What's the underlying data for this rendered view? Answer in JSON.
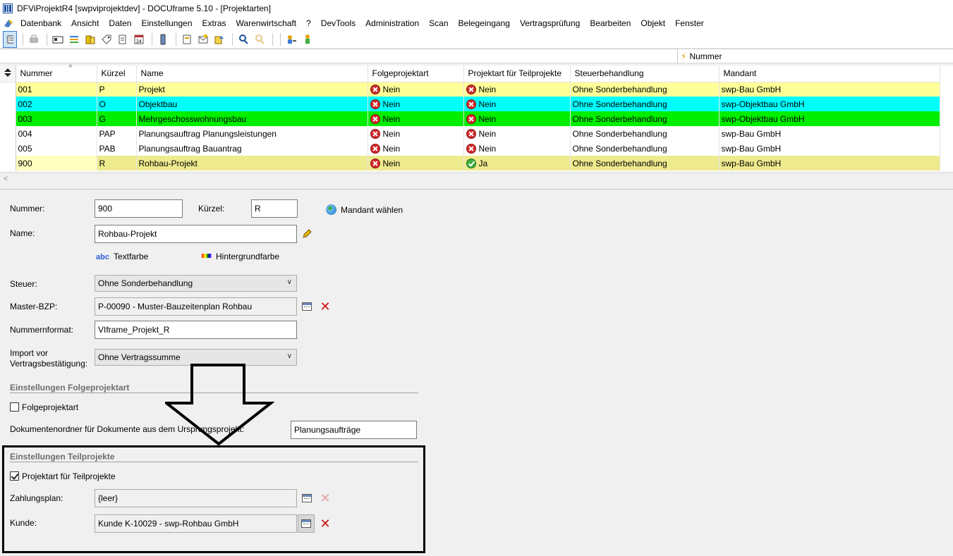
{
  "window": {
    "title": "DFViProjektR4 [swpviprojektdev] - DOCUframe 5.10 - [Projektarten]"
  },
  "menu": [
    "Datenbank",
    "Ansicht",
    "Daten",
    "Einstellungen",
    "Extras",
    "Warenwirtschaft",
    "?",
    "DevTools",
    "Administration",
    "Scan",
    "Belegeingang",
    "Vertragsprüfung",
    "Bearbeiten",
    "Objekt",
    "Fenster"
  ],
  "groupby": {
    "label": "Nummer"
  },
  "grid": {
    "columns": [
      "Nummer",
      "Kürzel",
      "Name",
      "Folgeprojektart",
      "Projektart für Teilprojekte",
      "Steuerbehandlung",
      "Mandant"
    ],
    "rows": [
      {
        "nummer": "001",
        "kuerzel": "P",
        "name": "Projekt",
        "folge": "Nein",
        "teil": "Nein",
        "teil_ok": false,
        "steuer": "Ohne Sonderbehandlung",
        "mandant": "swp-Bau GmbH",
        "color": "#ffff99"
      },
      {
        "nummer": "002",
        "kuerzel": "O",
        "name": "Objektbau",
        "folge": "Nein",
        "teil": "Nein",
        "teil_ok": false,
        "steuer": "Ohne Sonderbehandlung",
        "mandant": "swp-Objektbau GmbH",
        "color": "#00ffff"
      },
      {
        "nummer": "003",
        "kuerzel": "G",
        "name": "Mehrgeschosswohnungsbau",
        "folge": "Nein",
        "teil": "Nein",
        "teil_ok": false,
        "steuer": "Ohne Sonderbehandlung",
        "mandant": "swp-Objektbau GmbH",
        "color": "#00ee00"
      },
      {
        "nummer": "004",
        "kuerzel": "PAP",
        "name": "Planungsauftrag Planungsleistungen",
        "folge": "Nein",
        "teil": "Nein",
        "teil_ok": false,
        "steuer": "Ohne Sonderbehandlung",
        "mandant": "swp-Bau GmbH",
        "color": "#ffffff"
      },
      {
        "nummer": "005",
        "kuerzel": "PAB",
        "name": "Planungsauftrag Bauantrag",
        "folge": "Nein",
        "teil": "Nein",
        "teil_ok": false,
        "steuer": "Ohne Sonderbehandlung",
        "mandant": "swp-Bau GmbH",
        "color": "#ffffff"
      },
      {
        "nummer": "900",
        "kuerzel": "R",
        "name": "Rohbau-Projekt",
        "folge": "Nein",
        "teil": "Ja",
        "teil_ok": true,
        "steuer": "Ohne Sonderbehandlung",
        "mandant": "swp-Bau GmbH",
        "color": "#eeea8e",
        "selected": true
      }
    ]
  },
  "form": {
    "nummer_label": "Nummer:",
    "nummer_value": "900",
    "kuerzel_label": "Kürzel:",
    "kuerzel_value": "R",
    "mandant_button": "Mandant wählen",
    "name_label": "Name:",
    "name_value": "Rohbau-Projekt",
    "textfarbe": "Textfarbe",
    "hintergrundfarbe": "Hintergrundfarbe",
    "steuer_label": "Steuer:",
    "steuer_value": "Ohne Sonderbehandlung",
    "master_label": "Master-BZP:",
    "master_value": "P-00090 - Muster-Bauzeitenplan Rohbau",
    "nummernformat_label": "Nummernformat:",
    "nummernformat_value": "VIframe_Projekt_R",
    "import_label_1": "Import vor",
    "import_label_2": "Vertragsbestätigung:",
    "import_value": "Ohne Vertragssumme",
    "section_folge": "Einstellungen Folgeprojektart",
    "folge_checkbox": "Folgeprojektart",
    "folge_checked": false,
    "dokumentenordner_label": "Dokumentenordner für Dokumente aus dem Ursprungsprojekt:",
    "dokumentenordner_value": "Planungsaufträge",
    "section_teil": "Einstellungen Teilprojekte",
    "teil_checkbox": "Projektart für Teilprojekte",
    "teil_checked": true,
    "zahlungsplan_label": "Zahlungsplan:",
    "zahlungsplan_value": "{leer}",
    "kunde_label": "Kunde:",
    "kunde_value": "Kunde K-10029 - swp-Rohbau GmbH"
  }
}
